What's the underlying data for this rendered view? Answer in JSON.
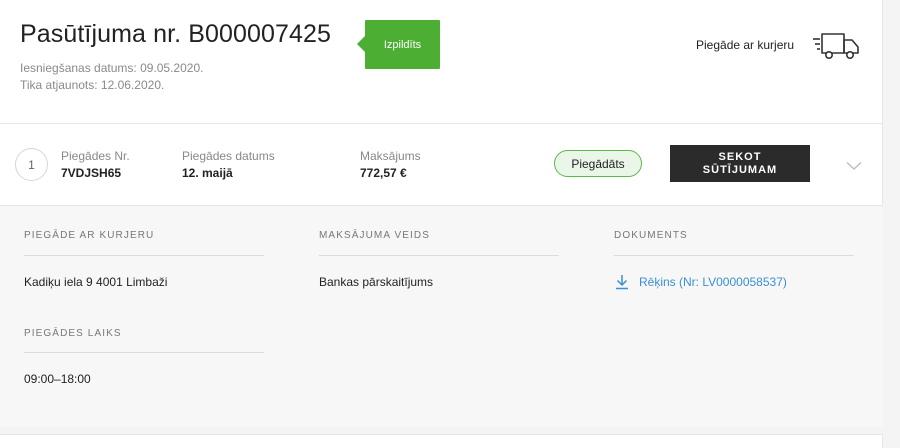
{
  "order": {
    "title": "Pasūtījuma nr. B000007425",
    "submitted": "Iesniegšanas datums: 09.05.2020.",
    "updated": "Tika atjaunots: 12.06.2020.",
    "status": "Izpildīts",
    "delivery_method": "Piegāde ar kurjeru"
  },
  "shipment": {
    "index": "1",
    "number_label": "Piegādes Nr.",
    "number_value": "7VDJSH65",
    "date_label": "Piegādes datums",
    "date_value": "12. maijā",
    "payment_label": "Maksājums",
    "payment_value": "772,57 €",
    "status_badge": "Piegādāts",
    "track_line1": "SEKOT",
    "track_line2": "SŪTĪJUMAM"
  },
  "details": {
    "courier_title": "PIEGĀDE AR KURJERU",
    "courier_address": "Kadiķu iela 9 4001 Limbaži",
    "payment_title": "MAKSĀJUMA VEIDS",
    "payment_type": "Bankas pārskaitījums",
    "document_title": "DOKUMENTS",
    "document_link": "Rēķins (Nr: LV0000058537)",
    "time_title": "PIEGĀDES LAIKS",
    "time_value": "09:00–18:00"
  },
  "colors": {
    "status_green": "#4cae33",
    "badge_border": "#5ab94a",
    "link_blue": "#3a8fd6",
    "button_dark": "#2b2b2b"
  },
  "icons": {
    "truck": "truck-icon",
    "chevron": "chevron-down-icon",
    "download": "download-icon"
  }
}
